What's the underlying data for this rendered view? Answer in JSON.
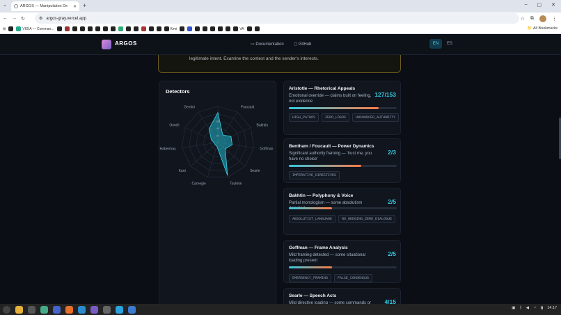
{
  "browser": {
    "tab_title": "ARGOS — Manipulation De",
    "url": "argos-gray.vercel.app",
    "bookmarks": [
      "VIGÍA — Comman...",
      "Kimi",
      "VA",
      "All Bookmarks"
    ]
  },
  "nav": {
    "brand": "ARGOS",
    "docs": "Documentation",
    "github": "GitHub",
    "lang_en": "EN",
    "lang_es": "ES"
  },
  "banner": {
    "text": "legitimate intent. Examine the context and the sender's interests."
  },
  "detectors": {
    "title": "Detectors",
    "radar_axes": [
      "Aristotle",
      "Foucault",
      "Bakhtin",
      "Goffman",
      "Searle",
      "Toulmin",
      "Carnegie",
      "Kant",
      "Habermas",
      "Orwell",
      "Gemini"
    ],
    "radar_values": [
      0.83,
      0.25,
      0.4,
      0.4,
      0.27,
      0.95,
      0.1,
      0.1,
      0.1,
      0.2,
      0.45
    ],
    "radar_tick_labels": [
      "60",
      "40",
      "20"
    ],
    "colors": {
      "fill": "#1fb5c9",
      "stroke": "#39d7ea",
      "grid": "#2a3140"
    }
  },
  "cards": [
    {
      "title": "Aristotle — Rhetorical Appeals",
      "desc": "Emotional override — claims built on feeling, not evidence",
      "score": "127/153",
      "fill": 0.83,
      "tags": [
        "HIGH_PATHOS",
        "ZERO_LOGOS",
        "UNSOURCED_AUTHORITY"
      ]
    },
    {
      "title": "Bentham / Foucault — Power Dynamics",
      "desc": "Significant authority framing — 'trust me, you have no choice'",
      "score": "2/3",
      "fill": 0.67,
      "tags": [
        "IMPERATIVE_DIRECTIVES"
      ]
    },
    {
      "title": "Bakhtin — Polyphony & Voice",
      "desc": "Partial monologism — some absolutism detected",
      "score": "2/5",
      "fill": 0.4,
      "tags": [
        "ABSOLUTIST_LANGUAGE",
        "NO_HEDGING_ZERO_DIALOGUE"
      ]
    },
    {
      "title": "Goffman — Frame Analysis",
      "desc": "Mild framing detected — some situational loading present",
      "score": "2/5",
      "fill": 0.4,
      "tags": [
        "EMERGENCY_FRAMING",
        "FALSE_CONSENSUS"
      ]
    },
    {
      "title": "Searle — Speech Acts",
      "desc": "Mild directive loading — some commands or",
      "score": "4/15",
      "fill": 0.27,
      "tags": []
    }
  ],
  "taskbar": {
    "clock": "14:17"
  }
}
